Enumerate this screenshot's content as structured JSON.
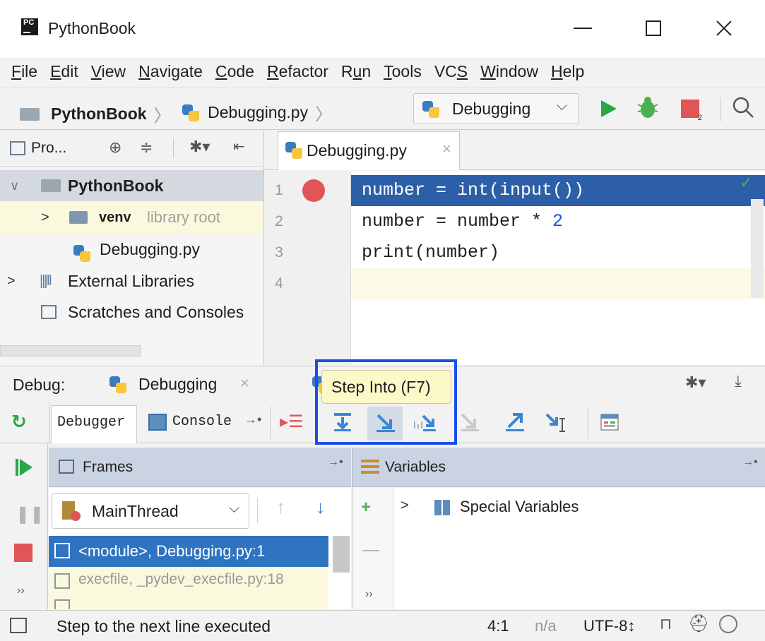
{
  "window": {
    "title": "PythonBook",
    "logo_text": "PC"
  },
  "menu": {
    "items": [
      "File",
      "Edit",
      "View",
      "Navigate",
      "Code",
      "Refactor",
      "Run",
      "Tools",
      "VCS",
      "Window",
      "Help"
    ],
    "underline_chars": [
      "F",
      "E",
      "V",
      "N",
      "C",
      "R",
      "u",
      "T",
      "S",
      "W",
      "H"
    ]
  },
  "navbar": {
    "project": "PythonBook",
    "file": "Debugging.py",
    "run_config": "Debugging"
  },
  "project_panel": {
    "header_label": "Pro...",
    "tree": {
      "root": "PythonBook",
      "venv": "venv",
      "venv_hint": "library root",
      "file": "Debugging.py",
      "external": "External Libraries",
      "scratches": "Scratches and Consoles"
    }
  },
  "editor": {
    "tab": "Debugging.py",
    "lines": [
      {
        "num": "1",
        "code": "number = int(input())"
      },
      {
        "num": "2",
        "code_parts": [
          "number = number * ",
          "2"
        ]
      },
      {
        "num": "3",
        "code": "print(number)"
      },
      {
        "num": "4",
        "code": ""
      }
    ]
  },
  "debug": {
    "label": "Debug:",
    "session_tab": "Debugging",
    "tooltip": "Step Into (F7)",
    "tabs": {
      "debugger": "Debugger",
      "console": "Console"
    },
    "frames_header": "Frames",
    "variables_header": "Variables",
    "thread": "MainThread",
    "frames": [
      "<module>, Debugging.py:1",
      "execfile, _pydev_execfile.py:18"
    ],
    "variables": [
      "Special Variables"
    ]
  },
  "statusbar": {
    "message": "Step to the next line executed",
    "position": "4:1",
    "na": "n/a",
    "encoding": "UTF-8↕"
  },
  "colors": {
    "accent": "#1a4fe6",
    "selection": "#2d5fa8",
    "frame_selected": "#2f74c0",
    "run_green": "#28a745",
    "stop_red": "#e05555",
    "tooltip_bg": "#fcf8c7"
  }
}
